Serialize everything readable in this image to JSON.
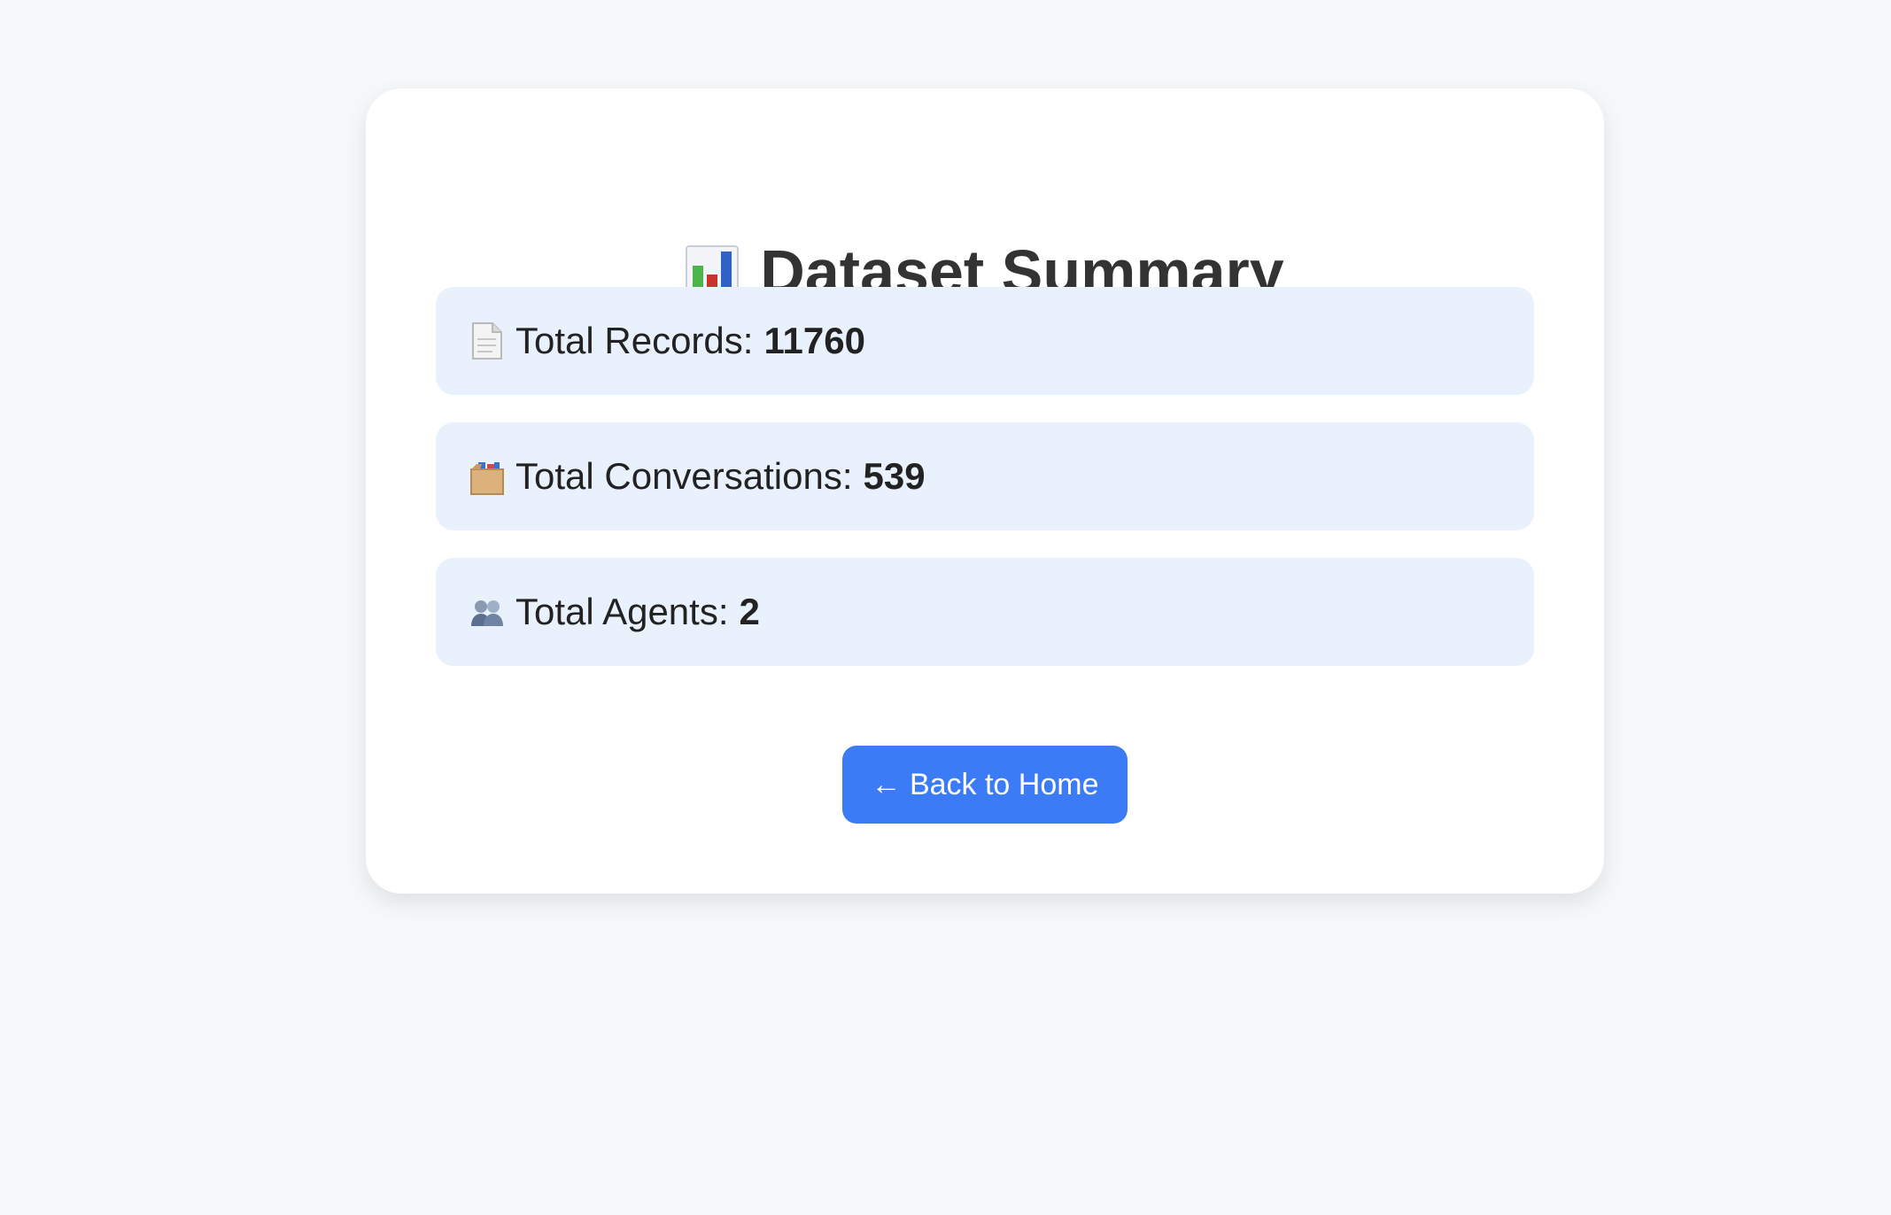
{
  "title": {
    "icon": "bar-chart-icon",
    "text": "Dataset Summary"
  },
  "stats": [
    {
      "icon": "page-icon",
      "label": "Total Records:",
      "value": "11760"
    },
    {
      "icon": "file-box-icon",
      "label": "Total Conversations:",
      "value": "539"
    },
    {
      "icon": "people-icon",
      "label": "Total Agents:",
      "value": "2"
    }
  ],
  "back_button": {
    "label": "← Back to Home"
  },
  "colors": {
    "background": "#f6f8fa",
    "card": "#ffffff",
    "stat_background": "#e9f1fd",
    "button": "#3b7cf6",
    "title_text": "#333333"
  }
}
